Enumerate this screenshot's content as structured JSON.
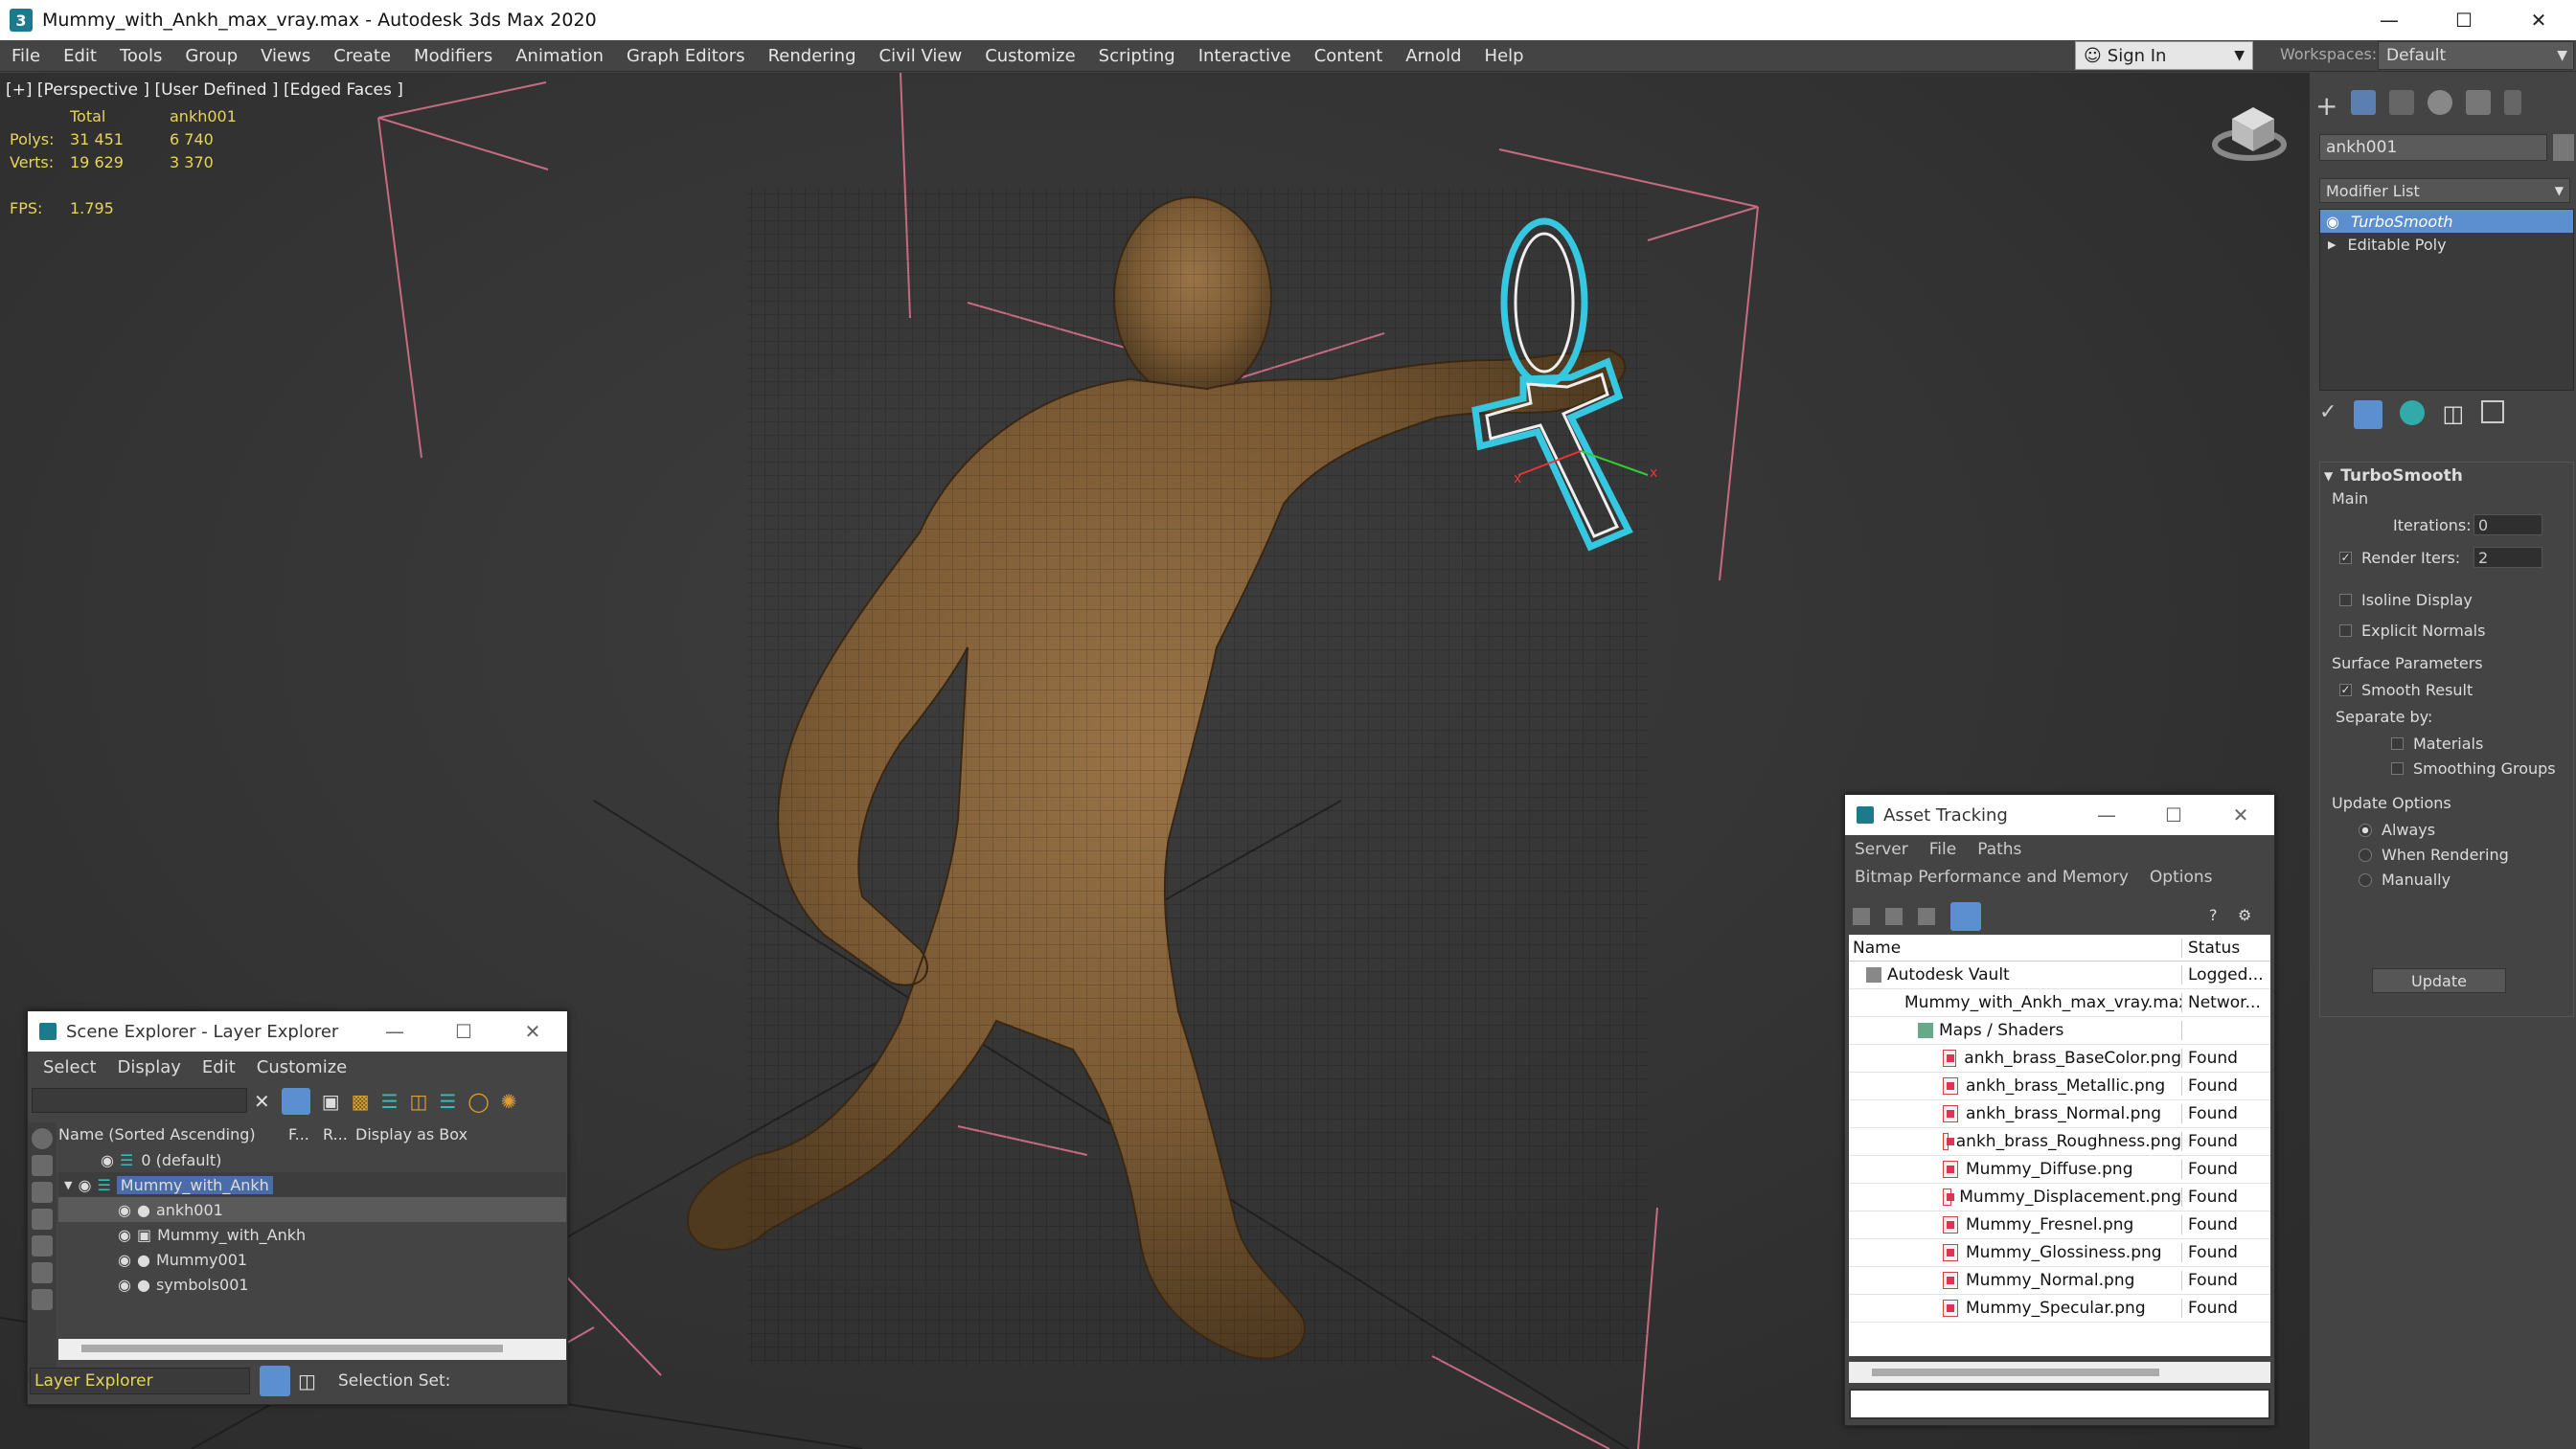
{
  "window": {
    "title": "Mummy_with_Ankh_max_vray.max - Autodesk 3ds Max 2020",
    "app_icon": "3"
  },
  "menu": [
    "File",
    "Edit",
    "Tools",
    "Group",
    "Views",
    "Create",
    "Modifiers",
    "Animation",
    "Graph Editors",
    "Rendering",
    "Civil View",
    "Customize",
    "Scripting",
    "Interactive",
    "Content",
    "Arnold",
    "Help"
  ],
  "signin": {
    "label": "Sign In"
  },
  "workspaces": {
    "label": "Workspaces:",
    "value": "Default"
  },
  "viewport": {
    "label": "[+] [Perspective ] [User Defined ] [Edged Faces ]",
    "stats": {
      "col_total": "Total",
      "col_obj": "ankh001",
      "polys_label": "Polys:",
      "polys_total": "31 451",
      "polys_obj": "6 740",
      "verts_label": "Verts:",
      "verts_total": "19 629",
      "verts_obj": "3 370",
      "fps_label": "FPS:",
      "fps_value": "1.795"
    }
  },
  "command_panel": {
    "object_name": "ankh001",
    "modifier_list": "Modifier List",
    "stack": [
      "TurboSmooth",
      "Editable Poly"
    ],
    "rollout_title": "TurboSmooth",
    "main_label": "Main",
    "iterations_label": "Iterations:",
    "iterations_value": "0",
    "render_iters_label": "Render Iters:",
    "render_iters_value": "2",
    "isoline": "Isoline Display",
    "explicit_normals": "Explicit Normals",
    "surface_params": "Surface Parameters",
    "smooth_result": "Smooth Result",
    "separate_by": "Separate by:",
    "materials": "Materials",
    "smoothing_groups": "Smoothing Groups",
    "update_options": "Update Options",
    "always": "Always",
    "when_rendering": "When Rendering",
    "manually": "Manually",
    "update_button": "Update"
  },
  "scene_explorer": {
    "title": "Scene Explorer - Layer Explorer",
    "menu": [
      "Select",
      "Display",
      "Edit",
      "Customize"
    ],
    "columns": {
      "name": "Name (Sorted Ascending)",
      "f": "F...",
      "r": "R...",
      "box": "Display as Box"
    },
    "rows": [
      {
        "label": "0 (default)"
      },
      {
        "label": "Mummy_with_Ankh"
      },
      {
        "label": "ankh001"
      },
      {
        "label": "Mummy_with_Ankh"
      },
      {
        "label": "Mummy001"
      },
      {
        "label": "symbols001"
      }
    ],
    "footer_dropdown": "Layer Explorer",
    "selection_set": "Selection Set:"
  },
  "asset_tracking": {
    "title": "Asset Tracking",
    "menu1": [
      "Server",
      "File",
      "Paths"
    ],
    "menu2": [
      "Bitmap Performance and Memory",
      "Options"
    ],
    "columns": {
      "name": "Name",
      "status": "Status"
    },
    "rows": [
      {
        "name": "Autodesk Vault",
        "status": "Logged..."
      },
      {
        "name": "Mummy_with_Ankh_max_vray.max",
        "status": "Networ..."
      },
      {
        "name": "Maps / Shaders",
        "status": ""
      },
      {
        "name": "ankh_brass_BaseColor.png",
        "status": "Found"
      },
      {
        "name": "ankh_brass_Metallic.png",
        "status": "Found"
      },
      {
        "name": "ankh_brass_Normal.png",
        "status": "Found"
      },
      {
        "name": "ankh_brass_Roughness.png",
        "status": "Found"
      },
      {
        "name": "Mummy_Diffuse.png",
        "status": "Found"
      },
      {
        "name": "Mummy_Displacement.png",
        "status": "Found"
      },
      {
        "name": "Mummy_Fresnel.png",
        "status": "Found"
      },
      {
        "name": "Mummy_Glossiness.png",
        "status": "Found"
      },
      {
        "name": "Mummy_Normal.png",
        "status": "Found"
      },
      {
        "name": "Mummy_Specular.png",
        "status": "Found"
      }
    ]
  },
  "colors": {
    "accent": "#5b8fd0",
    "stats": "#e8d45a",
    "selection": "#4aa0ff"
  }
}
